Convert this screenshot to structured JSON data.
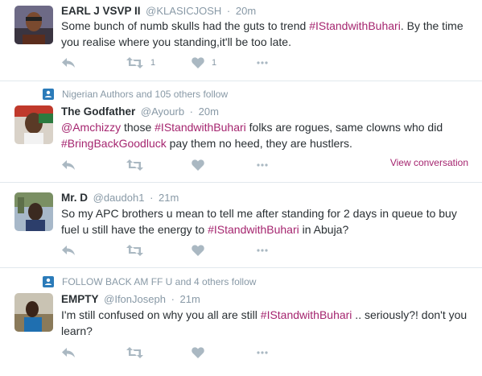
{
  "tweets": [
    {
      "context": "",
      "name": "EARL J VSVP II",
      "handle": "@KLASICJOSH",
      "time": "20m",
      "text": [
        {
          "t": "Some bunch of numb skulls had the guts to trend ",
          "type": "text"
        },
        {
          "t": "#IStandwithBuhari",
          "type": "hashtag"
        },
        {
          "t": ". By the time you realise where you standing,it'll be too late.",
          "type": "text"
        }
      ],
      "retweet_count": "1",
      "like_count": "1",
      "view_conversation": ""
    },
    {
      "context": "Nigerian Authors and 105 others follow",
      "name": "The Godfather",
      "handle": "@Ayourb",
      "time": "20m",
      "text": [
        {
          "t": "@Amchizzy",
          "type": "mention"
        },
        {
          "t": " those ",
          "type": "text"
        },
        {
          "t": "#IStandwithBuhari",
          "type": "hashtag"
        },
        {
          "t": " folks are rogues, same clowns who did ",
          "type": "text"
        },
        {
          "t": "#BringBackGoodluck",
          "type": "hashtag"
        },
        {
          "t": " pay them no heed, they are hustlers.",
          "type": "text"
        }
      ],
      "retweet_count": "",
      "like_count": "",
      "view_conversation": "View conversation"
    },
    {
      "context": "",
      "name": "Mr. D",
      "handle": "@daudoh1",
      "time": "21m",
      "text": [
        {
          "t": "So my APC brothers u mean to tell me after standing for 2 days in queue to buy fuel u still have the energy to ",
          "type": "text"
        },
        {
          "t": "#IStandwithBuhari",
          "type": "hashtag"
        },
        {
          "t": " in Abuja?",
          "type": "text"
        }
      ],
      "retweet_count": "",
      "like_count": "",
      "view_conversation": ""
    },
    {
      "context": "FOLLOW BACK AM FF U and 4 others follow",
      "name": "EMPTY",
      "handle": "@IfonJoseph",
      "time": "21m",
      "text": [
        {
          "t": "I'm still confused on why you all are still ",
          "type": "text"
        },
        {
          "t": "#IStandwithBuhari",
          "type": "hashtag"
        },
        {
          "t": " .. seriously?! don't you learn?",
          "type": "text"
        }
      ],
      "retweet_count": "",
      "like_count": "",
      "view_conversation": ""
    }
  ],
  "colors": {
    "link": "#a5256f",
    "muted": "#8899a6",
    "icon": "#aab8c2",
    "divider": "#e1e8ed",
    "context_icon": "#2b7bb9"
  },
  "icons": {
    "reply": "reply-icon",
    "retweet": "retweet-icon",
    "like": "heart-icon",
    "more": "more-icon",
    "context": "person-badge-icon"
  }
}
